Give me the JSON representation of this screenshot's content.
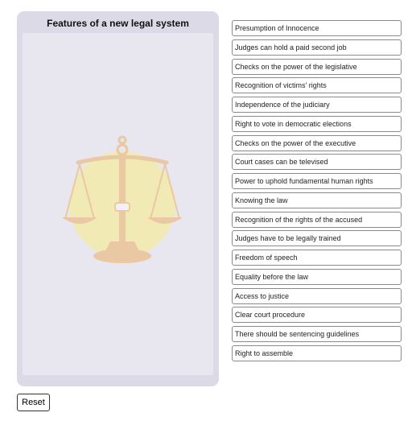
{
  "drop_panel": {
    "title": "Features of a new legal system"
  },
  "icons": {
    "scales": "scales-of-justice-icon"
  },
  "colors": {
    "panel_bg": "#dcdae7",
    "zone_bg": "#e8e6ee",
    "scales_glow": "#fff066",
    "scales_gold": "#f0a040"
  },
  "items": [
    {
      "label": "Presumption of Innocence"
    },
    {
      "label": "Judges can hold a paid second job"
    },
    {
      "label": "Checks on the power of the legislative"
    },
    {
      "label": "Recognition of victims' rights"
    },
    {
      "label": "Independence of the judiciary"
    },
    {
      "label": "Right to vote in democratic elections"
    },
    {
      "label": "Checks on the power of the executive"
    },
    {
      "label": "Court cases can be televised"
    },
    {
      "label": "Power to uphold fundamental human rights"
    },
    {
      "label": "Knowing the law"
    },
    {
      "label": "Recognition of the rights of the accused"
    },
    {
      "label": "Judges have to be legally trained"
    },
    {
      "label": "Freedom of speech"
    },
    {
      "label": "Equality before the law"
    },
    {
      "label": "Access to justice"
    },
    {
      "label": "Clear court procedure"
    },
    {
      "label": "There should be sentencing guidelines"
    },
    {
      "label": "Right to assemble"
    }
  ],
  "buttons": {
    "reset": "Reset"
  }
}
